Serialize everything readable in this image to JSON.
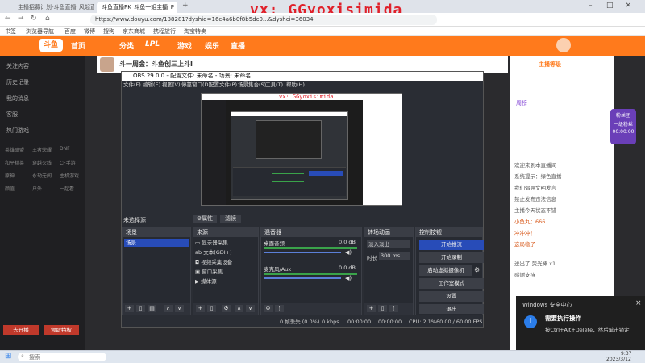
{
  "browser": {
    "tabs": [
      {
        "label": "主播招募计划-斗鱼直播_风起直播等你来"
      },
      {
        "label": "斗鱼直播PK_斗鱼一姐主播_P"
      }
    ],
    "url": "https://www.douyu.com/138281?dyshid=16c4a6b0f8b5dc0...&dyshci=36034",
    "bookmarks": [
      "书签",
      "浏览器导航",
      "百度",
      "微博",
      "搜狗",
      "京东商城",
      "携程旅行",
      "淘宝特卖"
    ]
  },
  "watermark": "vx: GGyoxisimida",
  "douyu": {
    "logo": "斗鱼",
    "nav": [
      "首页",
      "分类",
      "LPL",
      "游戏",
      "娱乐",
      "直播"
    ],
    "room_title": "斗一周金：斗鱼创三上斗I"
  },
  "sidebar": {
    "items": [
      "关注内容",
      "历史记录",
      "我的消息",
      "客服",
      "热门游戏"
    ],
    "grid": [
      "英雄联盟",
      "王者荣耀",
      "DNF",
      "和平精英",
      "穿越火线",
      "CF手游",
      "原神",
      "永劫无间",
      "主机游戏",
      "颜值",
      "户外",
      "一起看"
    ],
    "buttons": [
      "去开播",
      "领取特权"
    ]
  },
  "obs": {
    "title": "OBS 29.0.0 - 配置文件: 未命名 - 场景: 未命名",
    "menu": [
      "文件(F)",
      "编辑(E)",
      "视图(V)",
      "停靠窗口(D)",
      "配置文件(P)",
      "场景集合(S)",
      "工具(T)",
      "帮助(H)"
    ],
    "scene_label": "未选择源",
    "props_btn": "属性",
    "filter_btn": "滤镜",
    "panels": {
      "scenes": "场景",
      "sources": "来源",
      "mixer": "混音器",
      "transitions": "转场动画",
      "controls": "控制按钮"
    },
    "scene_item": "场景",
    "sources": [
      "显示器采集",
      "文本(GDI+)",
      "视频采集设备",
      "窗口采集",
      "媒体源"
    ],
    "mixer": [
      {
        "name": "桌面音频",
        "db": "0.0 dB"
      },
      {
        "name": "麦克风/Aux",
        "db": "0.0 dB"
      }
    ],
    "transition": {
      "type": "淡入淡出",
      "duration_label": "时长",
      "duration": "300 ms"
    },
    "controls": [
      "开始推流",
      "开始录制",
      "启动虚拟摄像机",
      "工作室模式",
      "设置",
      "退出"
    ],
    "status": {
      "dropped": "0 帧丢失 (0.0%)",
      "bitrate": "0 kbps",
      "live": "00:00:00",
      "rec": "00:00:00",
      "cpu": "CPU: 2.1%",
      "fps": "60.00 / 60.00 FPS"
    }
  },
  "chat": {
    "header": "主播等级",
    "badge": "周榜",
    "lines": [
      "欢迎来到本直播间",
      "系统提示：绿色直播",
      "我们倡导文明发言",
      "禁止发布违法信息",
      "主播今天状态不错",
      "小鱼丸：666",
      "冲冲冲！",
      "这局稳了",
      "送出了 荧光棒 x1",
      "感谢支持"
    ],
    "side_tag": "粉丝团",
    "side_val": "一级粉丝",
    "side_num": "00:00:00"
  },
  "toast": {
    "title": "Windows 安全中心",
    "heading": "需要执行操作",
    "body": "按Ctrl+Alt+Delete，然后单击锁定"
  },
  "taskbar": {
    "search": "搜索",
    "time": "9:37",
    "date": "2023/3/12"
  },
  "colors": {
    "douyu": "#ff7a1c",
    "obs_bg": "#2a2d34",
    "obs_btn": "#284cb8",
    "meter": "#3aa34a"
  }
}
